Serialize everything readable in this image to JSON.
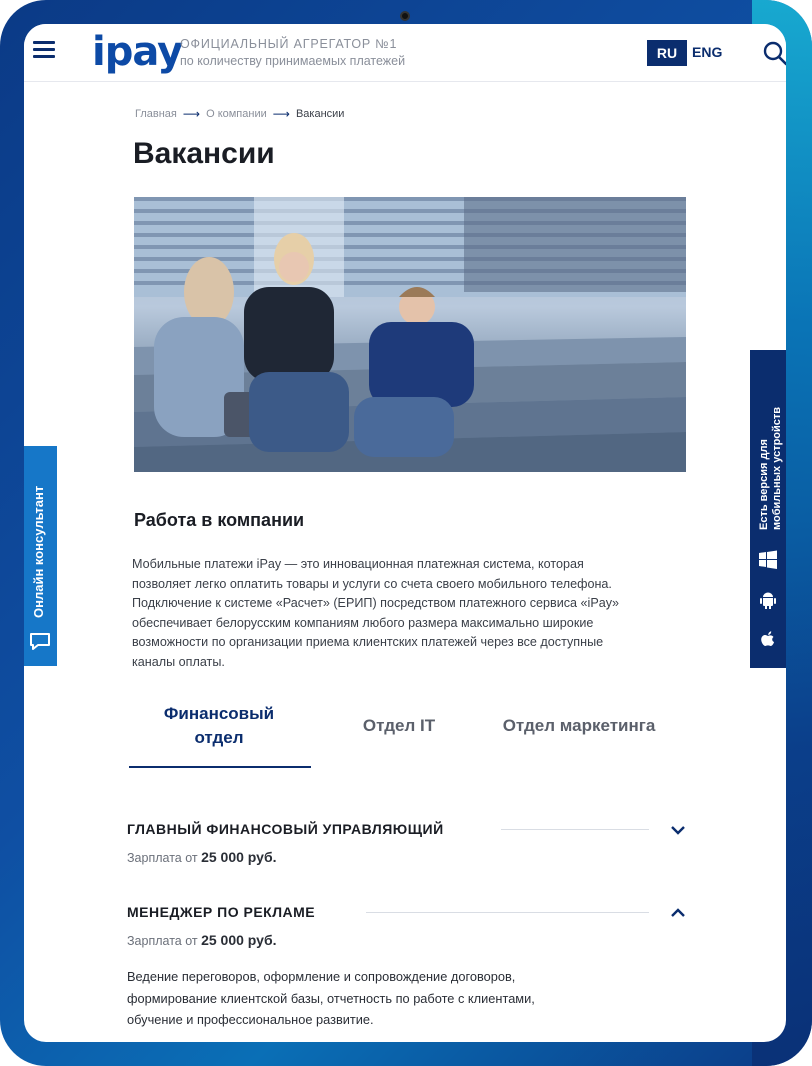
{
  "header": {
    "logo": "ipay",
    "tagline_line1": "ОФИЦИАЛЬНЫЙ АГРЕГАТОР №1",
    "tagline_line2": "по количеству принимаемых платежей",
    "lang_active": "RU",
    "lang_other": "ENG"
  },
  "breadcrumb": [
    "Главная",
    "О компании",
    "Вакансии"
  ],
  "page_title": "Вакансии",
  "section_title": "Работа в компании",
  "intro_lines": [
    "Мобильные платежи iPay — это инновационная платежная система, которая",
    "позволяет легко оплатить товары и услуги со счета своего мобильного телефона.",
    "Подключение к системе «Расчет» (ЕРИП) посредством платежного сервиса «iPay»",
    "обеспечивает белорусским компаниям любого размера максимально широкие",
    "возможности по организации приема клиентских платежей через все доступные",
    "каналы оплаты."
  ],
  "tabs": [
    {
      "label_line1": "Финансовый",
      "label_line2": "отдел",
      "active": true
    },
    {
      "label": "Отдел IT",
      "active": false
    },
    {
      "label": "Отдел маркетинга",
      "active": false
    }
  ],
  "vacancies": [
    {
      "title": "ГЛАВНЫЙ ФИНАНСОВЫЙ УПРАВЛЯЮЩИЙ",
      "salary_prefix": "Зарплата от",
      "salary_value": "25 000 руб.",
      "expanded": false
    },
    {
      "title": "МЕНЕДЖЕР ПО РЕКЛАМЕ",
      "salary_prefix": "Зарплата от",
      "salary_value": "25 000 руб.",
      "expanded": true,
      "description_lines": [
        "Ведение переговоров, оформление и сопровождение договоров,",
        "формирование клиентской базы, отчетность по работе с клиентами,",
        "обучение и профессиональное развитие."
      ]
    }
  ],
  "side": {
    "consultant_label": "Онлайн консультант",
    "mobile_label_line1": "Есть версия для",
    "mobile_label_line2": "мобильных устройств"
  },
  "icons": [
    "menu-icon",
    "search-icon",
    "arrow-right-icon",
    "chevron-down-icon",
    "chevron-up-icon",
    "chat-icon",
    "windows-icon",
    "android-icon",
    "apple-icon"
  ],
  "colors": {
    "brand_dark": "#0b2d6e",
    "brand_blue": "#0d4aa6",
    "consultant_blue": "#1677c8"
  }
}
